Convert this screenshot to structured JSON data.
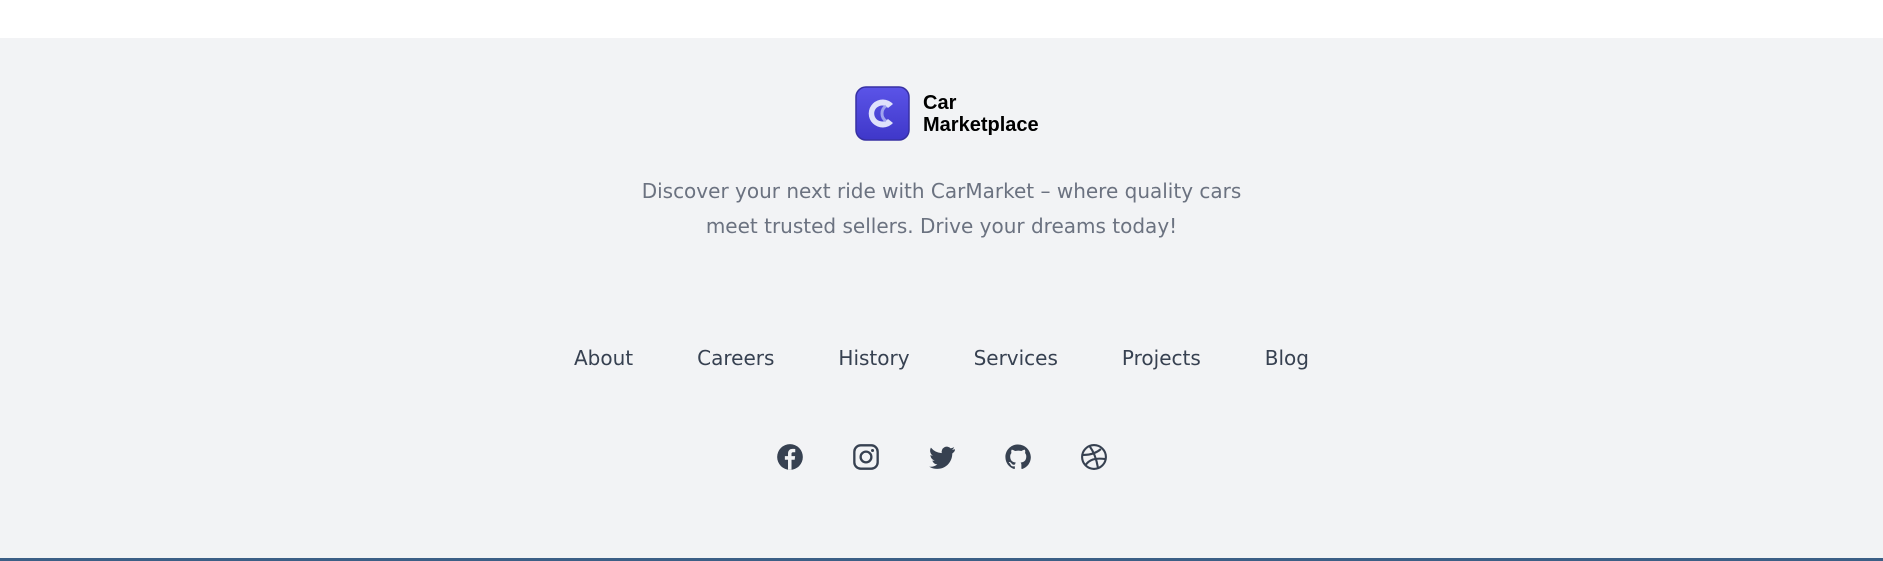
{
  "brand": {
    "name_line1": "Car",
    "name_line2": "Marketplace",
    "logo_icon": "car-marketplace-logo-icon",
    "logo_color": "#4f46e5"
  },
  "tagline": {
    "line1": "Discover your next ride with CarMarket – where quality cars",
    "line2": "meet trusted sellers. Drive your dreams today!"
  },
  "nav": {
    "items": [
      {
        "label": "About"
      },
      {
        "label": "Careers"
      },
      {
        "label": "History"
      },
      {
        "label": "Services"
      },
      {
        "label": "Projects"
      },
      {
        "label": "Blog"
      }
    ]
  },
  "social": {
    "icons": [
      "facebook-icon",
      "instagram-icon",
      "twitter-icon",
      "github-icon",
      "dribbble-icon"
    ],
    "color": "#374151"
  },
  "colors": {
    "footer_bg": "#f2f3f5",
    "text_muted": "#6b7280",
    "nav_text": "#374151",
    "bottom_rule": "#3b5f86"
  }
}
